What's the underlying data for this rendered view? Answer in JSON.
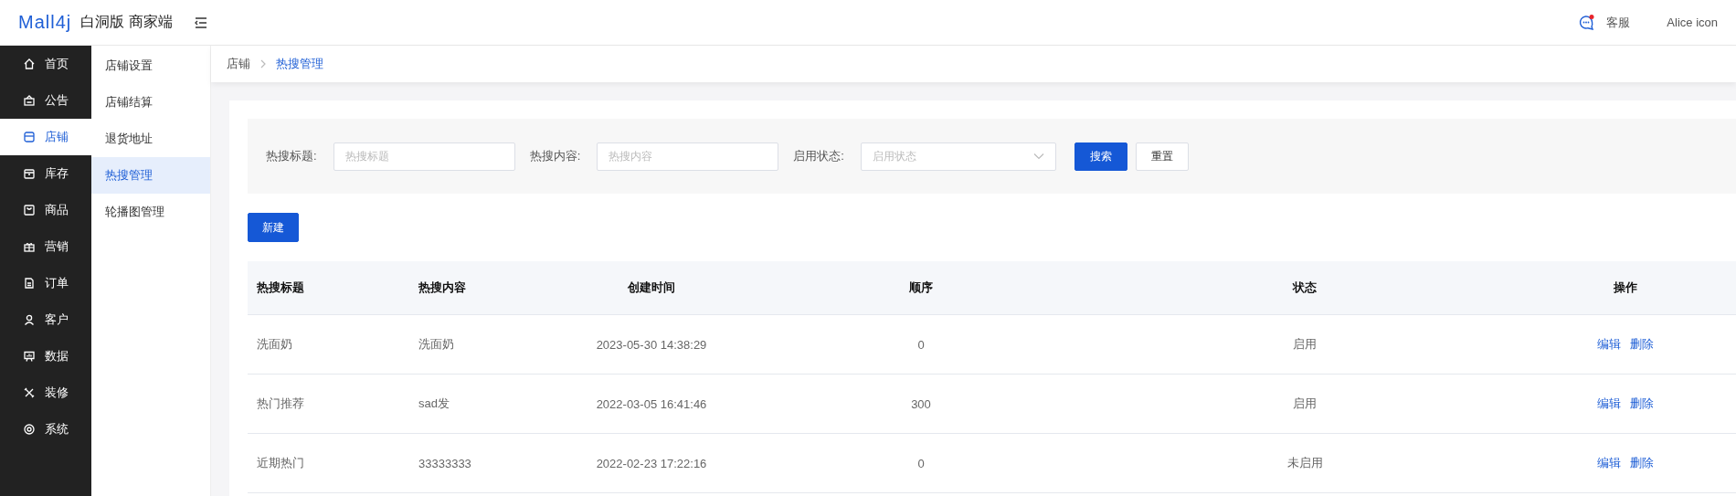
{
  "header": {
    "logo": "Mall4j",
    "title": "白洞版 商家端",
    "service": "客服",
    "user": "Alice icon"
  },
  "nav": [
    {
      "label": "首页",
      "selected": false
    },
    {
      "label": "公告",
      "selected": false
    },
    {
      "label": "店铺",
      "selected": true
    },
    {
      "label": "库存",
      "selected": false
    },
    {
      "label": "商品",
      "selected": false
    },
    {
      "label": "营销",
      "selected": false
    },
    {
      "label": "订单",
      "selected": false
    },
    {
      "label": "客户",
      "selected": false
    },
    {
      "label": "数据",
      "selected": false
    },
    {
      "label": "装修",
      "selected": false
    },
    {
      "label": "系统",
      "selected": false
    }
  ],
  "subnav": [
    {
      "label": "店铺设置",
      "selected": false
    },
    {
      "label": "店铺结算",
      "selected": false
    },
    {
      "label": "退货地址",
      "selected": false
    },
    {
      "label": "热搜管理",
      "selected": true
    },
    {
      "label": "轮播图管理",
      "selected": false
    }
  ],
  "breadcrumb": [
    "店铺",
    "热搜管理"
  ],
  "filters": [
    {
      "kind": "input",
      "label": "热搜标题:",
      "placeholder": "热搜标题"
    },
    {
      "kind": "input",
      "label": "热搜内容:",
      "placeholder": "热搜内容"
    },
    {
      "kind": "select",
      "label": "启用状态:",
      "placeholder": "启用状态"
    }
  ],
  "search_button": "搜索",
  "reset_button": "重置",
  "create_button": "新建",
  "table": {
    "columns": [
      "热搜标题",
      "热搜内容",
      "创建时间",
      "顺序",
      "状态",
      "操作"
    ],
    "rows": [
      {
        "cells": [
          "洗面奶",
          "洗面奶",
          "2023-05-30 14:38:29",
          "0",
          "启用"
        ],
        "actions": [
          "编辑",
          "删除"
        ]
      },
      {
        "cells": [
          "热门推荐",
          "sad发",
          "2022-03-05 16:41:46",
          "300",
          "启用"
        ],
        "actions": [
          "编辑",
          "删除"
        ]
      },
      {
        "cells": [
          "近期热门",
          "33333333",
          "2022-02-23 17:22:16",
          "0",
          "未启用"
        ],
        "actions": [
          "编辑",
          "删除"
        ]
      }
    ]
  }
}
